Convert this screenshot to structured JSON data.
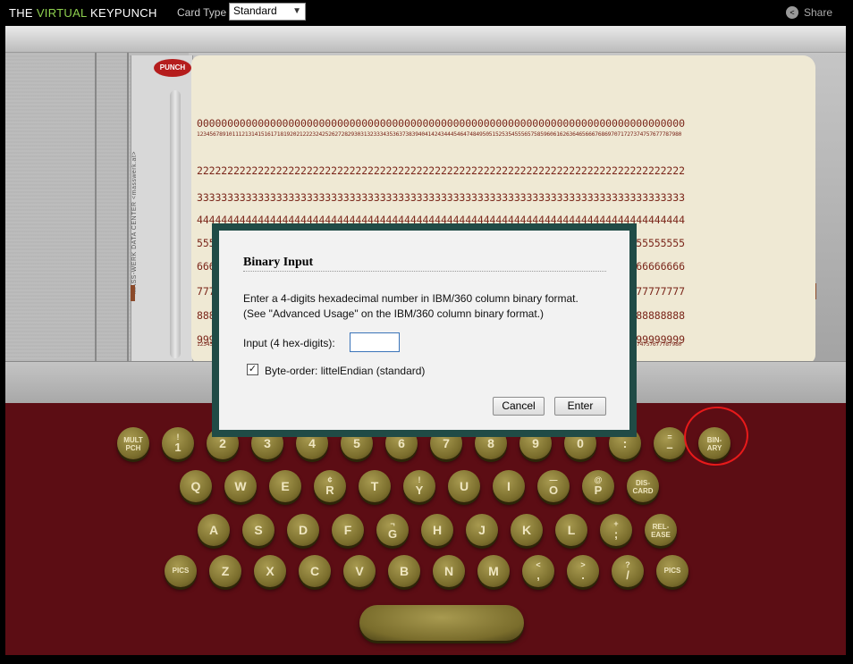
{
  "topbar": {
    "title_prefix": "THE ",
    "title_highlight": "VIRTUAL",
    "title_suffix": " KEYPUNCH",
    "card_type_label": "Card Type",
    "card_type_value": "Standard",
    "share_label": "Share"
  },
  "card": {
    "slot_badge": "PUNCH",
    "slot_text": "MASS-WERK DATA CENTER  <masswerk.at>",
    "slot_corner": "5081 ... 2815",
    "digit_rows": [
      "0",
      "1",
      "2",
      "3",
      "4",
      "5",
      "6",
      "7",
      "8",
      "9"
    ]
  },
  "dialog": {
    "title": "Binary Input",
    "line1": "Enter a 4-digits hexadecimal number in IBM/360 column binary format.",
    "line2": "(See \"Advanced Usage\" on the IBM/360 column binary format.)",
    "input_label": "Input (4 hex-digits):",
    "input_value": "",
    "checkbox_checked": true,
    "checkbox_label": "Byte-order: littelEndian (standard)",
    "cancel_label": "Cancel",
    "enter_label": "Enter"
  },
  "keyboard": {
    "row1": [
      {
        "name": "mult-pch",
        "top": "MULT",
        "main": "PCH"
      },
      {
        "name": "1",
        "top": "!",
        "main": "1"
      },
      {
        "name": "2",
        "top": "",
        "main": "2"
      },
      {
        "name": "3",
        "top": "",
        "main": "3"
      },
      {
        "name": "4",
        "top": "",
        "main": "4"
      },
      {
        "name": "5",
        "top": "",
        "main": "5"
      },
      {
        "name": "6",
        "top": "",
        "main": "6"
      },
      {
        "name": "7",
        "top": "",
        "main": "7"
      },
      {
        "name": "8",
        "top": "",
        "main": "8"
      },
      {
        "name": "9",
        "top": "",
        "main": "9"
      },
      {
        "name": "0",
        "top": "",
        "main": "0"
      },
      {
        "name": "colon",
        "top": "",
        "main": ":"
      },
      {
        "name": "minus",
        "top": "=",
        "main": "–"
      },
      {
        "name": "binary",
        "top": "BIN-",
        "main": "ARY"
      }
    ],
    "row2": [
      {
        "name": "q",
        "top": "",
        "main": "Q"
      },
      {
        "name": "w",
        "top": "",
        "main": "W"
      },
      {
        "name": "e",
        "top": "",
        "main": "E"
      },
      {
        "name": "r",
        "top": "¢",
        "main": "R"
      },
      {
        "name": "t",
        "top": "",
        "main": "T"
      },
      {
        "name": "y",
        "top": "!",
        "main": "Y"
      },
      {
        "name": "u",
        "top": "",
        "main": "U"
      },
      {
        "name": "i",
        "top": "",
        "main": "I"
      },
      {
        "name": "o",
        "top": "—",
        "main": "O"
      },
      {
        "name": "p",
        "top": "@",
        "main": "P"
      },
      {
        "name": "discard",
        "top": "DIS-",
        "main": "CARD"
      }
    ],
    "row3": [
      {
        "name": "a",
        "top": "",
        "main": "A"
      },
      {
        "name": "s",
        "top": "",
        "main": "S"
      },
      {
        "name": "d",
        "top": "",
        "main": "D"
      },
      {
        "name": "f",
        "top": "",
        "main": "F"
      },
      {
        "name": "g",
        "top": "¬",
        "main": "G"
      },
      {
        "name": "h",
        "top": "",
        "main": "H"
      },
      {
        "name": "j",
        "top": "",
        "main": "J"
      },
      {
        "name": "k",
        "top": "",
        "main": "K"
      },
      {
        "name": "l",
        "top": "",
        "main": "L"
      },
      {
        "name": "plus-semicolon",
        "top": "+",
        "main": ";"
      },
      {
        "name": "release",
        "top": "REL-",
        "main": "EASE"
      }
    ],
    "row4": [
      {
        "name": "pics-left",
        "top": "",
        "main": "PICS"
      },
      {
        "name": "z",
        "top": "",
        "main": "Z"
      },
      {
        "name": "x",
        "top": "",
        "main": "X"
      },
      {
        "name": "c",
        "top": "",
        "main": "C"
      },
      {
        "name": "v",
        "top": "",
        "main": "V"
      },
      {
        "name": "b",
        "top": "",
        "main": "B"
      },
      {
        "name": "n",
        "top": "",
        "main": "N"
      },
      {
        "name": "m",
        "top": "",
        "main": "M"
      },
      {
        "name": "lt-comma",
        "top": "<",
        "main": ","
      },
      {
        "name": "gt-period",
        "top": ">",
        "main": "."
      },
      {
        "name": "question-slash",
        "top": "?",
        "main": "/"
      },
      {
        "name": "pics-right",
        "top": "",
        "main": "PICS"
      }
    ]
  }
}
